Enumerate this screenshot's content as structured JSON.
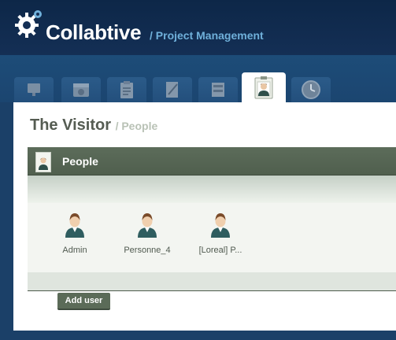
{
  "app": {
    "name": "Collabtive",
    "subtitle": "/ Project Management"
  },
  "tabs": [
    {
      "icon": "desktop-icon",
      "active": false
    },
    {
      "icon": "calendar-icon",
      "active": false
    },
    {
      "icon": "clipboard-icon",
      "active": false
    },
    {
      "icon": "edit-document-icon",
      "active": false
    },
    {
      "icon": "files-icon",
      "active": false
    },
    {
      "icon": "user-badge-icon",
      "active": true
    },
    {
      "icon": "clock-icon",
      "active": false
    }
  ],
  "page": {
    "title": "The Visitor",
    "crumb": "/ People"
  },
  "block": {
    "title": "People",
    "icon": "user-badge-icon"
  },
  "people": [
    {
      "name": "Admin"
    },
    {
      "name": "Personne_4"
    },
    {
      "name": "[Loreal] P..."
    }
  ],
  "actions": {
    "add_user": "Add user"
  },
  "colors": {
    "header": "#0d2748",
    "accent": "#6fb0da",
    "block_header": "#5c6c5a"
  }
}
